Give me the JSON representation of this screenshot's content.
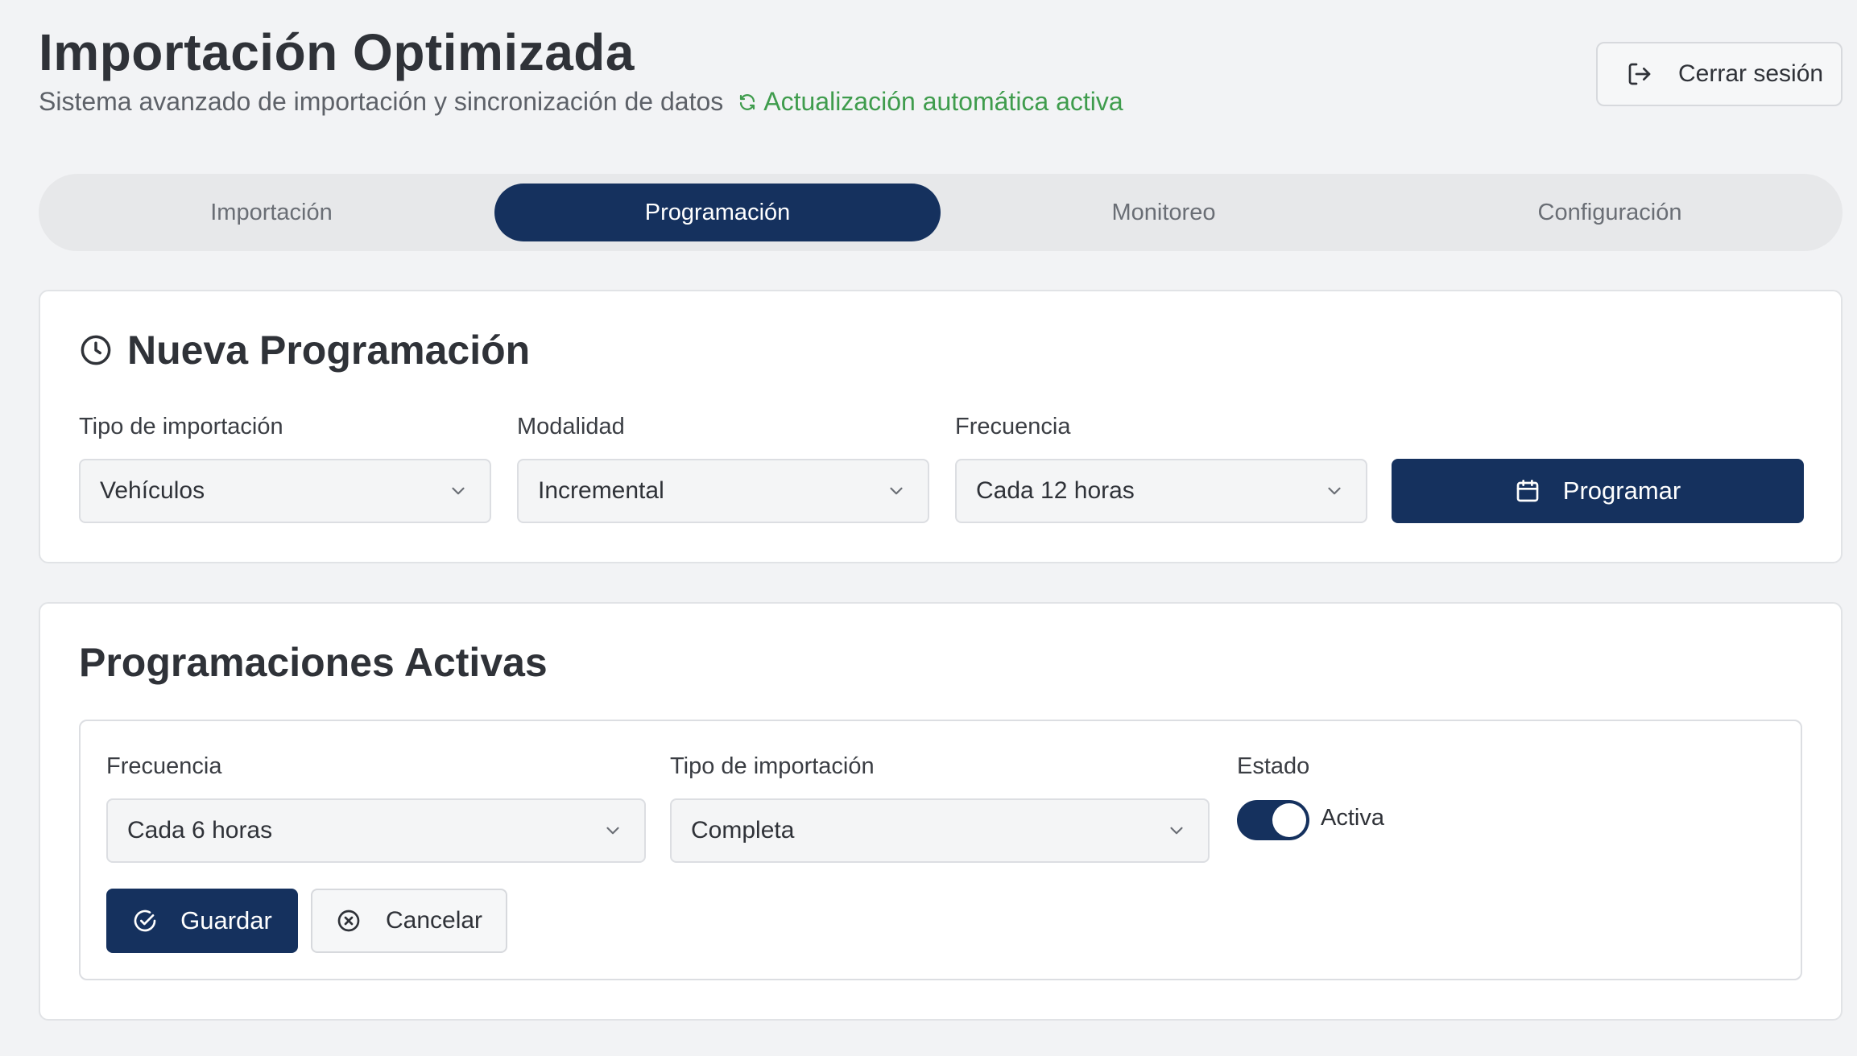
{
  "header": {
    "title": "Importación Optimizada",
    "subtitle": "Sistema avanzado de importación y sincronización de datos",
    "auto_status": "Actualización automática activa",
    "logout_label": "Cerrar sesión"
  },
  "tabs": [
    {
      "label": "Importación",
      "active": false
    },
    {
      "label": "Programación",
      "active": true
    },
    {
      "label": "Monitoreo",
      "active": false
    },
    {
      "label": "Configuración",
      "active": false
    }
  ],
  "new_schedule": {
    "title": "Nueva Programación",
    "fields": {
      "tipo_label": "Tipo de importación",
      "tipo_value": "Vehículos",
      "modalidad_label": "Modalidad",
      "modalidad_value": "Incremental",
      "frecuencia_label": "Frecuencia",
      "frecuencia_value": "Cada 12 horas"
    },
    "program_button": "Programar"
  },
  "active_schedules": {
    "title": "Programaciones Activas",
    "item": {
      "frecuencia_label": "Frecuencia",
      "frecuencia_value": "Cada 6 horas",
      "tipo_label": "Tipo de importación",
      "tipo_value": "Completa",
      "estado_label": "Estado",
      "estado_value": "Activa",
      "estado_on": true,
      "save_label": "Guardar",
      "cancel_label": "Cancelar"
    }
  },
  "colors": {
    "primary": "#15315e",
    "status_green": "#3f9c4d",
    "background": "#f2f3f5"
  }
}
